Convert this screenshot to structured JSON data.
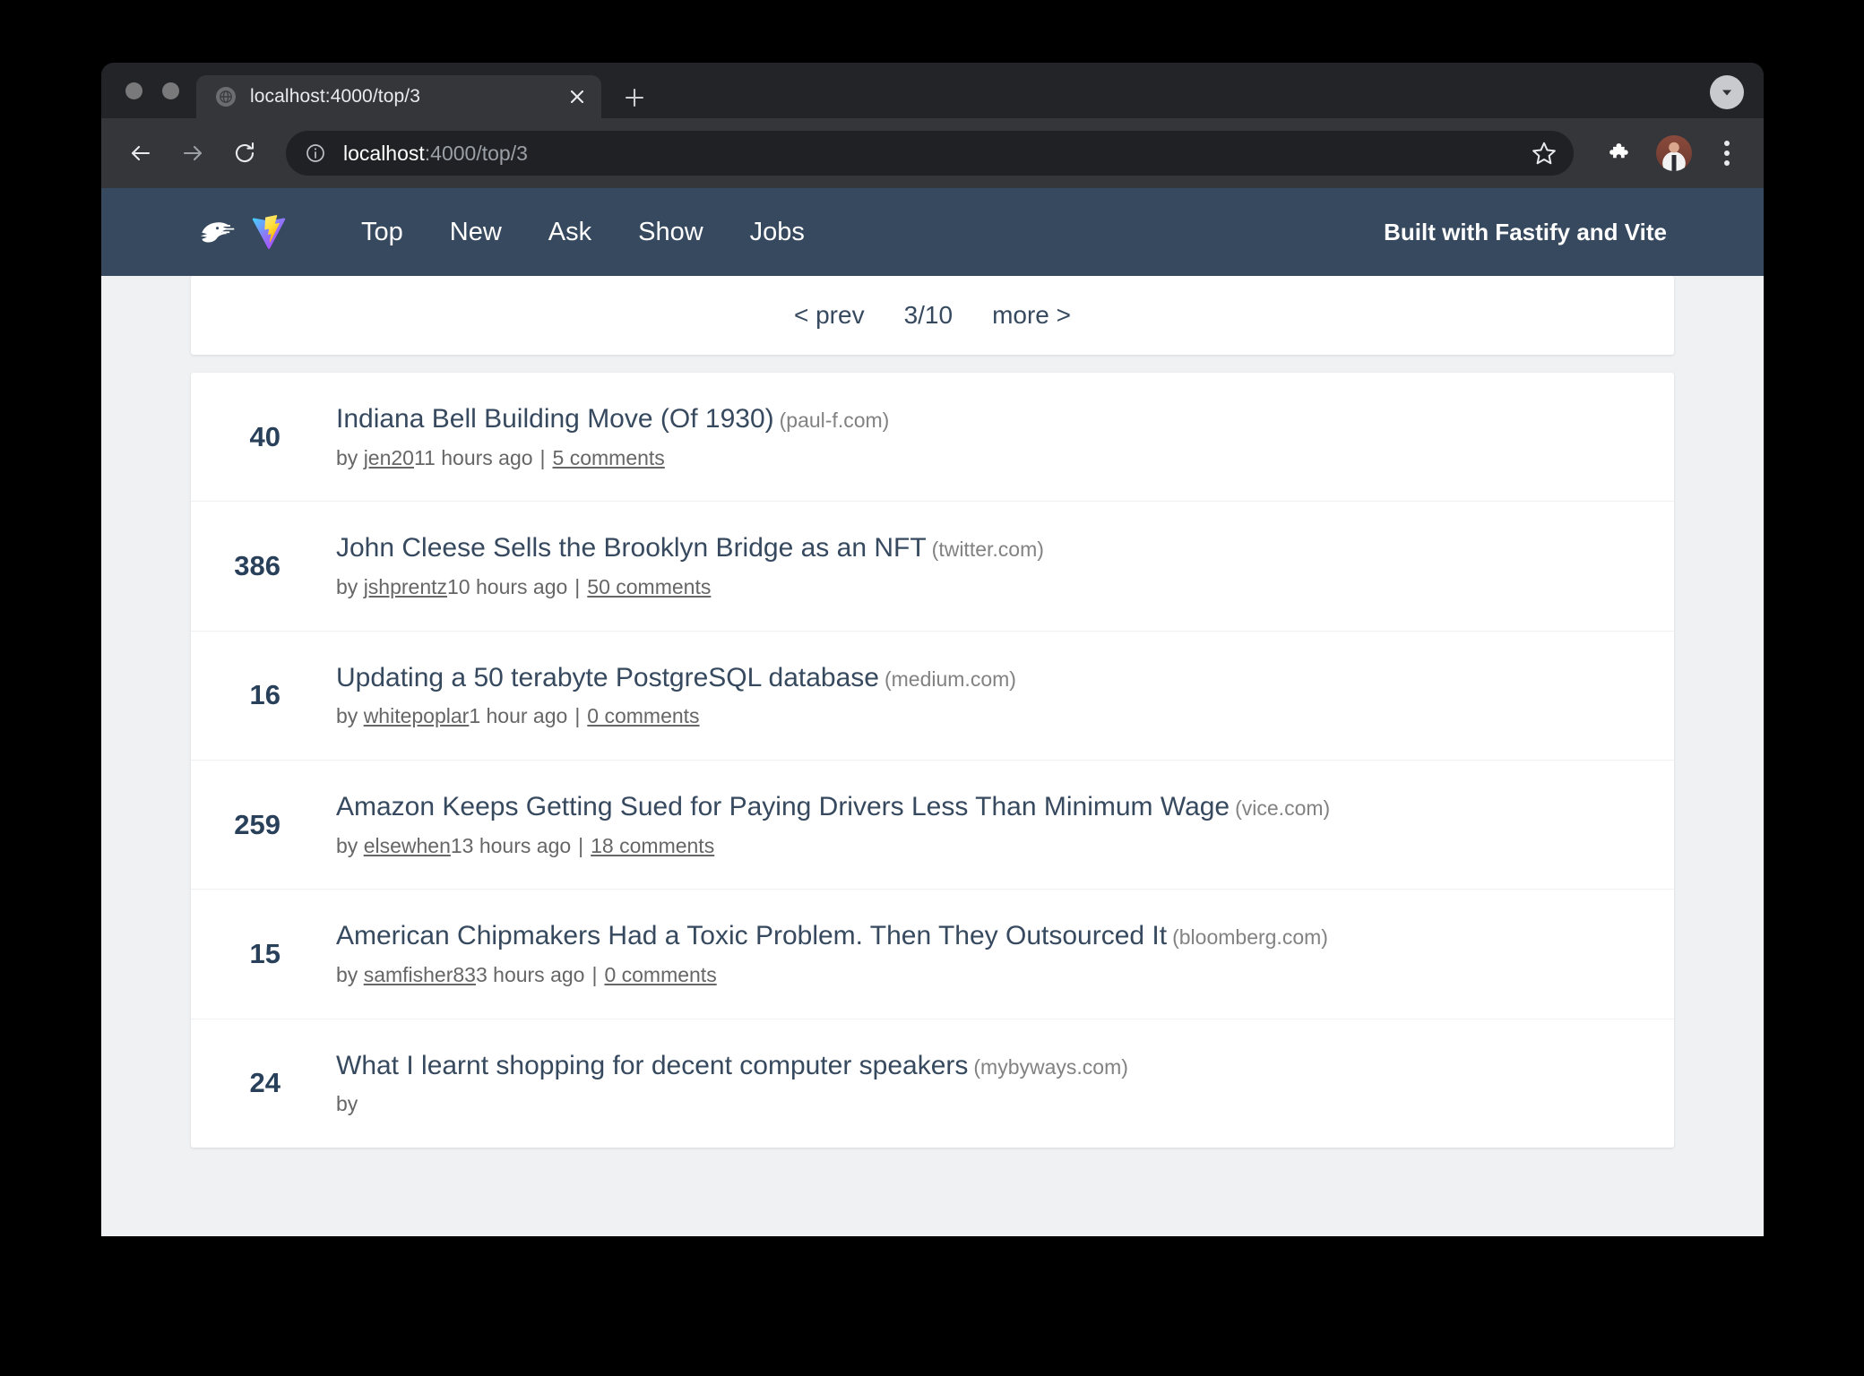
{
  "browser": {
    "tab": {
      "title": "localhost:4000/top/3",
      "favicon": "globe-icon",
      "close": "×"
    },
    "new_tab": "+",
    "tab_list": "▾",
    "toolbar": {
      "back": "←",
      "forward": "→",
      "reload": "↻",
      "info_icon": "info-circle-icon",
      "url_host": "localhost",
      "url_rest": ":4000/top/3",
      "bookmark": "star-icon",
      "extensions": "puzzle-icon",
      "profile": "avatar",
      "menu": "three-dot-menu-icon"
    }
  },
  "site": {
    "logos": [
      "fastify-logo",
      "vite-logo"
    ],
    "nav_links": [
      {
        "label": "Top"
      },
      {
        "label": "New"
      },
      {
        "label": "Ask"
      },
      {
        "label": "Show"
      },
      {
        "label": "Jobs"
      }
    ],
    "tagline": "Built with Fastify and Vite"
  },
  "pagination": {
    "prev": "< prev",
    "current": "3/10",
    "next": "more >"
  },
  "stories": [
    {
      "score": "40",
      "title": "Indiana Bell Building Move (Of 1930)",
      "domain": "(paul-f.com)",
      "by": "by ",
      "user": "jen20",
      "time": "11 hours ago",
      "sep": "|",
      "comments": "5 comments"
    },
    {
      "score": "386",
      "title": "John Cleese Sells the Brooklyn Bridge as an NFT",
      "domain": "(twitter.com)",
      "by": "by ",
      "user": "jshprentz",
      "time": "10 hours ago",
      "sep": "|",
      "comments": "50 comments"
    },
    {
      "score": "16",
      "title": "Updating a 50 terabyte PostgreSQL database",
      "domain": "(medium.com)",
      "by": "by ",
      "user": "whitepoplar",
      "time": "1 hour ago",
      "sep": "|",
      "comments": "0 comments"
    },
    {
      "score": "259",
      "title": "Amazon Keeps Getting Sued for Paying Drivers Less Than Minimum Wage",
      "domain": "(vice.com)",
      "by": "by ",
      "user": "elsewhen",
      "time": "13 hours ago",
      "sep": "|",
      "comments": "18 comments"
    },
    {
      "score": "15",
      "title": "American Chipmakers Had a Toxic Problem. Then They Outsourced It",
      "domain": "(bloomberg.com)",
      "by": "by ",
      "user": "samfisher83",
      "time": "3 hours ago",
      "sep": "|",
      "comments": "0 comments"
    },
    {
      "score": "24",
      "title": "What I learnt shopping for decent computer speakers",
      "domain": "(mybyways.com)",
      "by": "by ",
      "user": "",
      "time": "",
      "sep": "",
      "comments": ""
    }
  ],
  "colors": {
    "navbar": "#36495e",
    "page_bg": "#f0f1f3",
    "card": "#ffffff",
    "link": "#36495e",
    "muted": "#666666",
    "domain": "#828282",
    "chrome_tabstrip": "#232427",
    "chrome_toolbar": "#35363a",
    "omnibox": "#202124"
  }
}
